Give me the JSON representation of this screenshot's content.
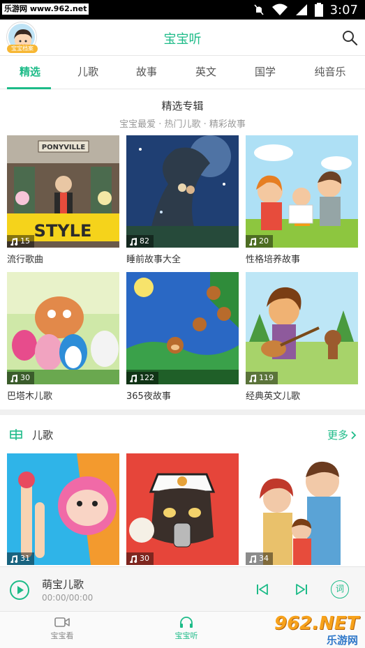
{
  "status_bar": {
    "watermark": "乐游网 www.962.net",
    "time": "3:07"
  },
  "header": {
    "title": "宝宝听",
    "avatar_tag": "宝宝档案"
  },
  "tabs": [
    {
      "label": "精选",
      "active": true
    },
    {
      "label": "儿歌"
    },
    {
      "label": "故事"
    },
    {
      "label": "英文"
    },
    {
      "label": "国学"
    },
    {
      "label": "纯音乐"
    }
  ],
  "featured": {
    "title": "精选专辑",
    "subtitle": "宝宝最爱 · 热门儿歌 · 精彩故事",
    "albums": [
      {
        "label": "流行歌曲",
        "count": "15",
        "poster_text": "PONYVILLE"
      },
      {
        "label": "睡前故事大全",
        "count": "82"
      },
      {
        "label": "性格培养故事",
        "count": "20"
      },
      {
        "label": "巴塔木儿歌",
        "count": "30"
      },
      {
        "label": "365夜故事",
        "count": "122"
      },
      {
        "label": "经典英文儿歌",
        "count": "119"
      }
    ]
  },
  "erge": {
    "title": "儿歌",
    "more_label": "更多",
    "albums": [
      {
        "count": "31"
      },
      {
        "count": "30"
      },
      {
        "count": "34"
      }
    ]
  },
  "player": {
    "title": "萌宝儿歌",
    "time": "00:00/00:00",
    "lyric_label": "词"
  },
  "bottom_nav": [
    {
      "label": "宝宝看"
    },
    {
      "label": "宝宝听",
      "active": true
    }
  ],
  "watermark": {
    "big": "962.NET",
    "small": "乐游网"
  },
  "colors": {
    "accent": "#1dbb88",
    "statusbar": "#000000"
  },
  "icons": [
    "wifi-icon",
    "signal-icon",
    "battery-icon",
    "search-icon",
    "music-note-icon",
    "prev-icon",
    "next-icon",
    "video-icon",
    "headphones-icon"
  ]
}
